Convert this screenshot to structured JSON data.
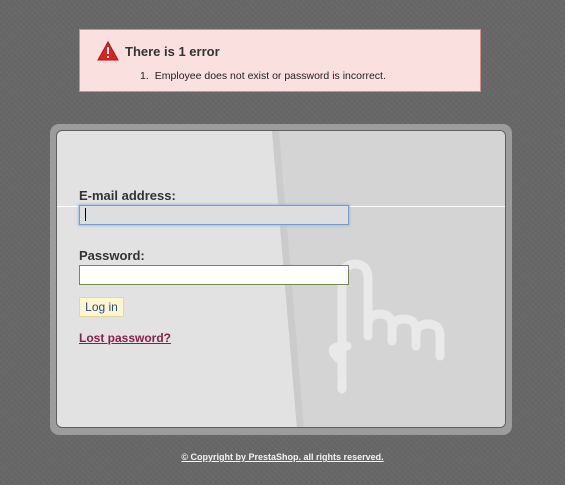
{
  "error": {
    "title": "There is 1 error",
    "items": [
      {
        "number": "1.",
        "text": "Employee does not exist or password is incorrect."
      }
    ],
    "icon": "warning-triangle-icon",
    "icon_color": "#e02020"
  },
  "login": {
    "email_label": "E-mail address:",
    "email_value": "",
    "password_label": "Password:",
    "password_value": "",
    "login_button": "Log in",
    "lost_password": "Lost password?"
  },
  "footer": {
    "copyright": "© Copyright by PrestaShop. all rights reserved."
  },
  "colors": {
    "background": "#676767",
    "panel": "#e2e2e2",
    "error_bg": "#fbe0e0",
    "link": "#8a1f4a"
  }
}
